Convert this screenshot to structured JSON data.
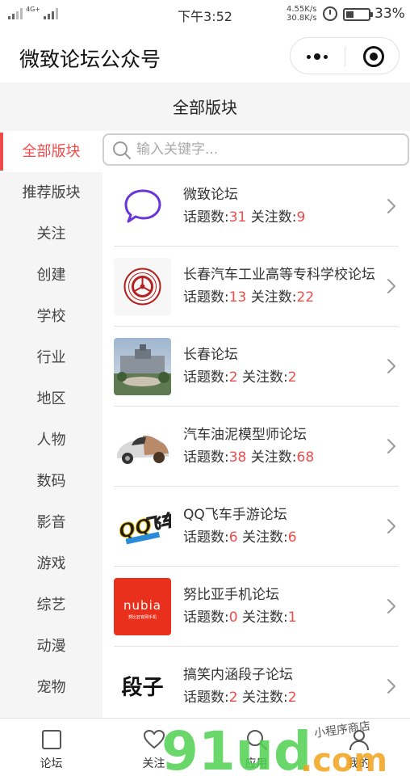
{
  "status_bar": {
    "network": "4G+",
    "time": "下午3:52",
    "speed_up": "4.55K/s",
    "speed_down": "30.8K/s",
    "battery_level": 0.33,
    "battery_text": "33%"
  },
  "nav": {
    "title": "微致论坛公众号"
  },
  "section_title": "全部版块",
  "search": {
    "placeholder": "输入关键字..."
  },
  "sidebar": {
    "items": [
      {
        "label": "全部版块",
        "active": true
      },
      {
        "label": "推荐版块",
        "active": false
      },
      {
        "label": "关注",
        "active": false
      },
      {
        "label": "创建",
        "active": false
      },
      {
        "label": "学校",
        "active": false
      },
      {
        "label": "行业",
        "active": false
      },
      {
        "label": "地区",
        "active": false
      },
      {
        "label": "人物",
        "active": false
      },
      {
        "label": "数码",
        "active": false
      },
      {
        "label": "影音",
        "active": false
      },
      {
        "label": "游戏",
        "active": false
      },
      {
        "label": "综艺",
        "active": false
      },
      {
        "label": "动漫",
        "active": false
      },
      {
        "label": "宠物",
        "active": false
      }
    ]
  },
  "forums": {
    "topics_label": "话题数:",
    "follows_label": "关注数:",
    "items": [
      {
        "name": "微致论坛",
        "topics": "31",
        "follows": "9",
        "logo": "chat-bubble-icon"
      },
      {
        "name": "长春汽车工业高等专科学校论坛",
        "topics": "13",
        "follows": "22",
        "logo": "school-seal-logo"
      },
      {
        "name": "长春论坛",
        "topics": "2",
        "follows": "2",
        "logo": "city-photo"
      },
      {
        "name": "汽车油泥模型师论坛",
        "topics": "38",
        "follows": "68",
        "logo": "car-model-photo"
      },
      {
        "name": "QQ飞车手游论坛",
        "topics": "6",
        "follows": "6",
        "logo": "qq-speed-logo"
      },
      {
        "name": "努比亚手机论坛",
        "topics": "0",
        "follows": "1",
        "logo": "nubia-logo",
        "logo_text": "nubia",
        "logo_subtext": "努比亚官网手机"
      },
      {
        "name": "搞笑内涵段子论坛",
        "topics": "2",
        "follows": "2",
        "logo": "duanzi-logo",
        "logo_text": "段子"
      }
    ]
  },
  "tab_bar": {
    "tabs": [
      {
        "label": "论坛",
        "icon": "square-icon"
      },
      {
        "label": "关注",
        "icon": "heart-icon"
      },
      {
        "label": "应用",
        "icon": "search-icon"
      },
      {
        "label": "我的",
        "icon": "user-icon"
      }
    ]
  },
  "watermark": {
    "main": "91ud",
    "suffix": ".com",
    "tagline": "小程序商店"
  },
  "colors": {
    "accent": "#f04b4b",
    "sidebar_bg": "#f5f5f5",
    "chat_purple": "#6a35d8",
    "nubia_red": "#e8301c"
  }
}
